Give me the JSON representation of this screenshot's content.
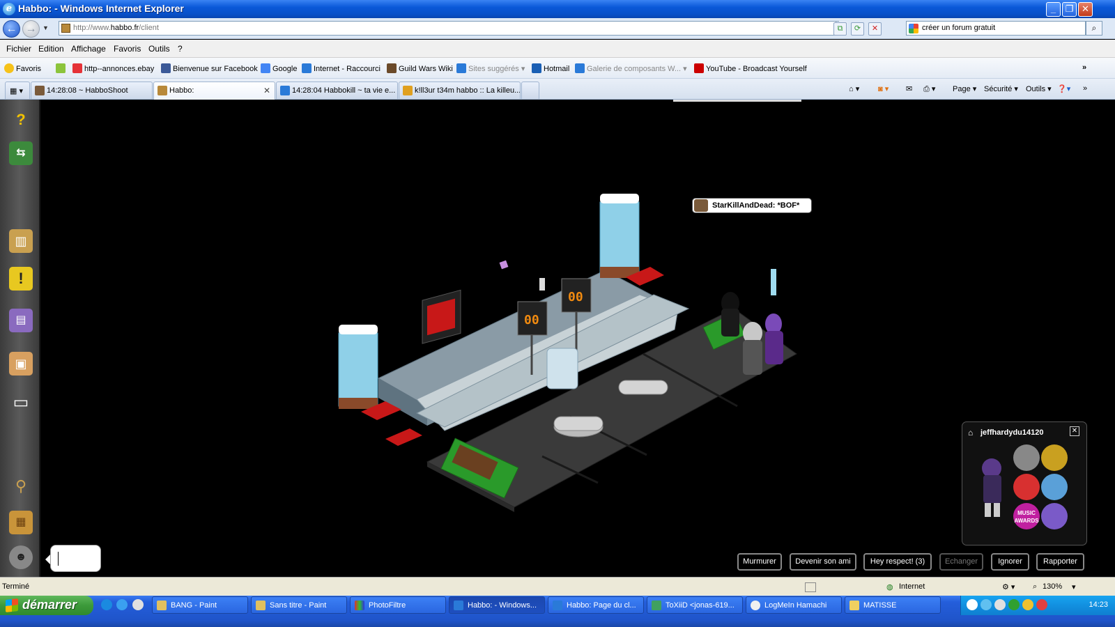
{
  "window": {
    "title": "Habbo: - Windows Internet Explorer"
  },
  "address": {
    "url_prefix": "http://www.",
    "url_host": "habbo.fr",
    "url_suffix": "/client",
    "search_value": "créer un forum gratuit"
  },
  "menu": [
    "Fichier",
    "Edition",
    "Affichage",
    "Favoris",
    "Outils",
    "?"
  ],
  "favorites": {
    "label": "Favoris",
    "items": [
      {
        "label": "http--annonces.ebay",
        "color": "#e53238"
      },
      {
        "label": "Bienvenue sur Facebook",
        "color": "#3b5998"
      },
      {
        "label": "Google",
        "color": "#4285f4"
      },
      {
        "label": "Internet - Raccourci",
        "color": "#2a7ad8"
      },
      {
        "label": "Guild Wars Wiki",
        "color": "#6b4a2a"
      },
      {
        "label": "Sites suggérés",
        "color": "#2a7ad8"
      },
      {
        "label": "Hotmail",
        "color": "#1a5fb4"
      },
      {
        "label": "Galerie de composants W...",
        "color": "#2a7ad8"
      },
      {
        "label": "YouTube - Broadcast Yourself",
        "color": "#cc0000"
      }
    ]
  },
  "tabs": [
    {
      "label": "14:28:08 ~ HabboShoot"
    },
    {
      "label": "Habbo:"
    },
    {
      "label": "14:28:04 Habbokill ~ ta vie e..."
    },
    {
      "label": "k!ll3ur t34m habbo :: La killeu..."
    }
  ],
  "commandbar": {
    "page": "Page",
    "security": "Sécurité",
    "tools": "Outils"
  },
  "room": {
    "speech_user": "StarKillAndDead:",
    "speech_text": "*BOF*",
    "scoreboard_left": "00",
    "scoreboard_right": "00"
  },
  "user_panel": {
    "username": "jeffhardydu14120",
    "badges": [
      "badge-1",
      "badge-2",
      "badge-3",
      "badge-4",
      "MUSIC AWARDS",
      "badge-6"
    ]
  },
  "actions": [
    "Murmurer",
    "Devenir son ami",
    "Hey respect! (3)",
    "Echanger",
    "Ignorer",
    "Rapporter"
  ],
  "status": {
    "left": "Terminé",
    "zone": "Internet",
    "zoom": "130%"
  },
  "taskbar": {
    "start": "démarrer",
    "tasks": [
      "BANG - Paint",
      "Sans titre - Paint",
      "PhotoFiltre",
      "Habbo: - Windows...",
      "Habbo: Page du cl...",
      "ToXiiD <jonas-619...",
      "LogMeIn Hamachi",
      "MATISSE"
    ],
    "clock": "14:23"
  }
}
